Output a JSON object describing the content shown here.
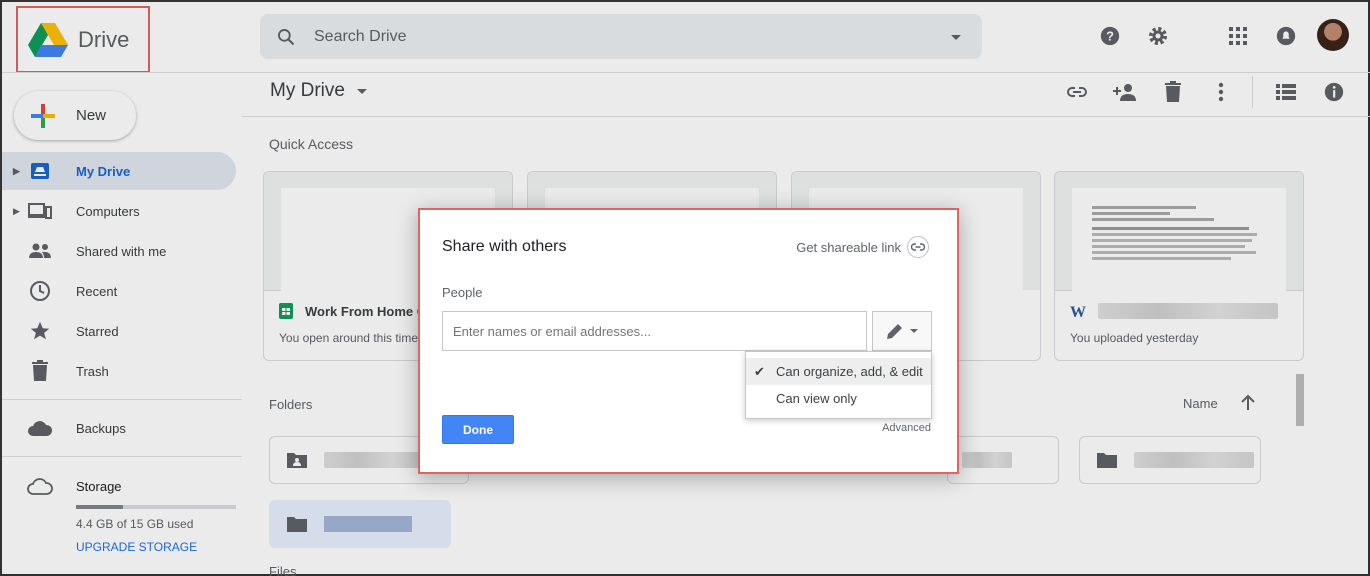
{
  "header": {
    "app_name": "Drive",
    "search_placeholder": "Search Drive"
  },
  "sidebar": {
    "new_label": "New",
    "items": [
      {
        "label": "My Drive",
        "icon": "my-drive-icon",
        "active": true
      },
      {
        "label": "Computers",
        "icon": "computers-icon"
      },
      {
        "label": "Shared with me",
        "icon": "shared-icon"
      },
      {
        "label": "Recent",
        "icon": "clock-icon"
      },
      {
        "label": "Starred",
        "icon": "star-icon"
      },
      {
        "label": "Trash",
        "icon": "trash-icon"
      }
    ],
    "backups_label": "Backups",
    "storage_label": "Storage",
    "storage_used": "4.4 GB of 15 GB used",
    "storage_fraction": 0.293,
    "upgrade_label": "UPGRADE STORAGE"
  },
  "main": {
    "title": "My Drive",
    "quick_access_label": "Quick Access",
    "cards": [
      {
        "title": "Work From Home C",
        "subtitle": "You open around this time"
      },
      {
        "title": "",
        "subtitle": ""
      },
      {
        "title": "",
        "subtitle": ""
      },
      {
        "title": "",
        "subtitle": "You uploaded yesterday"
      }
    ],
    "folders_label": "Folders",
    "sort_label": "Name",
    "files_label": "Files"
  },
  "dialog": {
    "title": "Share with others",
    "shareable_link": "Get shareable link",
    "people_label": "People",
    "input_placeholder": "Enter names or email addresses...",
    "permission_options": [
      "Can organize, add, & edit",
      "Can view only"
    ],
    "selected_permission": "Can organize, add, & edit",
    "done_label": "Done",
    "advanced_label": "Advanced"
  },
  "colors": {
    "accent": "#4285f4",
    "highlight_border": "#e06464",
    "active_nav": "#1967d2"
  }
}
